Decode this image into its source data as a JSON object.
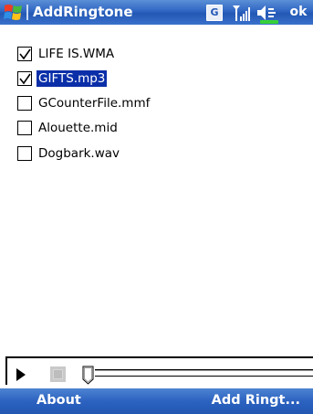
{
  "titlebar": {
    "app_title": "AddRingtone",
    "g_badge": "G",
    "ok_label": "ok",
    "icons": [
      "windows-start-icon",
      "g-badge-icon",
      "signal-icon",
      "speaker-icon",
      "battery-icon"
    ]
  },
  "files": [
    {
      "name": "LIFE IS.WMA",
      "checked": true,
      "selected": false
    },
    {
      "name": "GIFTS.mp3",
      "checked": true,
      "selected": true
    },
    {
      "name": "GCounterFile.mmf",
      "checked": false,
      "selected": false
    },
    {
      "name": "Alouette.mid",
      "checked": false,
      "selected": false
    },
    {
      "name": "Dogbark.wav",
      "checked": false,
      "selected": false
    }
  ],
  "player": {
    "controls": [
      "play-icon",
      "stop-icon"
    ],
    "position_fraction": 0
  },
  "softkeys": {
    "left": "About",
    "right": "Add Ringt..."
  },
  "colors": {
    "titlebar": "#2f66c3",
    "selection": "#0b2fa8",
    "battery": "#37d13a"
  }
}
